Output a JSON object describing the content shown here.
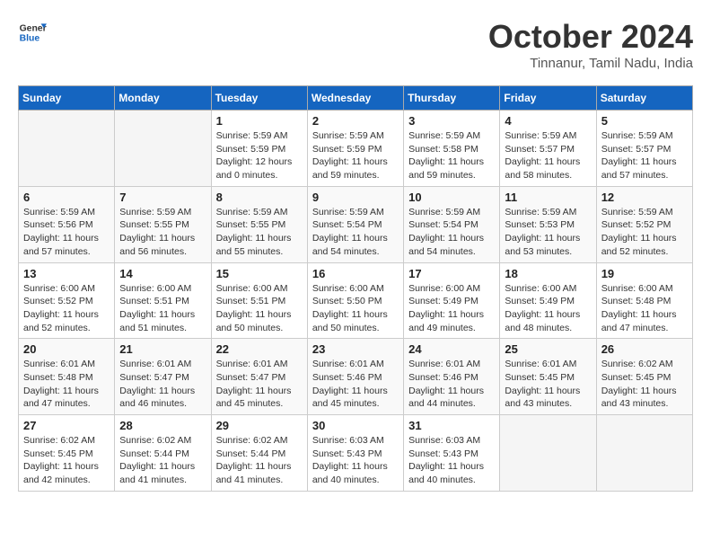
{
  "logo": {
    "line1": "General",
    "line2": "Blue"
  },
  "title": "October 2024",
  "subtitle": "Tinnanur, Tamil Nadu, India",
  "days_of_week": [
    "Sunday",
    "Monday",
    "Tuesday",
    "Wednesday",
    "Thursday",
    "Friday",
    "Saturday"
  ],
  "weeks": [
    [
      {
        "day": "",
        "info": ""
      },
      {
        "day": "",
        "info": ""
      },
      {
        "day": "1",
        "info": "Sunrise: 5:59 AM\nSunset: 5:59 PM\nDaylight: 12 hours\nand 0 minutes."
      },
      {
        "day": "2",
        "info": "Sunrise: 5:59 AM\nSunset: 5:59 PM\nDaylight: 11 hours\nand 59 minutes."
      },
      {
        "day": "3",
        "info": "Sunrise: 5:59 AM\nSunset: 5:58 PM\nDaylight: 11 hours\nand 59 minutes."
      },
      {
        "day": "4",
        "info": "Sunrise: 5:59 AM\nSunset: 5:57 PM\nDaylight: 11 hours\nand 58 minutes."
      },
      {
        "day": "5",
        "info": "Sunrise: 5:59 AM\nSunset: 5:57 PM\nDaylight: 11 hours\nand 57 minutes."
      }
    ],
    [
      {
        "day": "6",
        "info": "Sunrise: 5:59 AM\nSunset: 5:56 PM\nDaylight: 11 hours\nand 57 minutes."
      },
      {
        "day": "7",
        "info": "Sunrise: 5:59 AM\nSunset: 5:55 PM\nDaylight: 11 hours\nand 56 minutes."
      },
      {
        "day": "8",
        "info": "Sunrise: 5:59 AM\nSunset: 5:55 PM\nDaylight: 11 hours\nand 55 minutes."
      },
      {
        "day": "9",
        "info": "Sunrise: 5:59 AM\nSunset: 5:54 PM\nDaylight: 11 hours\nand 54 minutes."
      },
      {
        "day": "10",
        "info": "Sunrise: 5:59 AM\nSunset: 5:54 PM\nDaylight: 11 hours\nand 54 minutes."
      },
      {
        "day": "11",
        "info": "Sunrise: 5:59 AM\nSunset: 5:53 PM\nDaylight: 11 hours\nand 53 minutes."
      },
      {
        "day": "12",
        "info": "Sunrise: 5:59 AM\nSunset: 5:52 PM\nDaylight: 11 hours\nand 52 minutes."
      }
    ],
    [
      {
        "day": "13",
        "info": "Sunrise: 6:00 AM\nSunset: 5:52 PM\nDaylight: 11 hours\nand 52 minutes."
      },
      {
        "day": "14",
        "info": "Sunrise: 6:00 AM\nSunset: 5:51 PM\nDaylight: 11 hours\nand 51 minutes."
      },
      {
        "day": "15",
        "info": "Sunrise: 6:00 AM\nSunset: 5:51 PM\nDaylight: 11 hours\nand 50 minutes."
      },
      {
        "day": "16",
        "info": "Sunrise: 6:00 AM\nSunset: 5:50 PM\nDaylight: 11 hours\nand 50 minutes."
      },
      {
        "day": "17",
        "info": "Sunrise: 6:00 AM\nSunset: 5:49 PM\nDaylight: 11 hours\nand 49 minutes."
      },
      {
        "day": "18",
        "info": "Sunrise: 6:00 AM\nSunset: 5:49 PM\nDaylight: 11 hours\nand 48 minutes."
      },
      {
        "day": "19",
        "info": "Sunrise: 6:00 AM\nSunset: 5:48 PM\nDaylight: 11 hours\nand 47 minutes."
      }
    ],
    [
      {
        "day": "20",
        "info": "Sunrise: 6:01 AM\nSunset: 5:48 PM\nDaylight: 11 hours\nand 47 minutes."
      },
      {
        "day": "21",
        "info": "Sunrise: 6:01 AM\nSunset: 5:47 PM\nDaylight: 11 hours\nand 46 minutes."
      },
      {
        "day": "22",
        "info": "Sunrise: 6:01 AM\nSunset: 5:47 PM\nDaylight: 11 hours\nand 45 minutes."
      },
      {
        "day": "23",
        "info": "Sunrise: 6:01 AM\nSunset: 5:46 PM\nDaylight: 11 hours\nand 45 minutes."
      },
      {
        "day": "24",
        "info": "Sunrise: 6:01 AM\nSunset: 5:46 PM\nDaylight: 11 hours\nand 44 minutes."
      },
      {
        "day": "25",
        "info": "Sunrise: 6:01 AM\nSunset: 5:45 PM\nDaylight: 11 hours\nand 43 minutes."
      },
      {
        "day": "26",
        "info": "Sunrise: 6:02 AM\nSunset: 5:45 PM\nDaylight: 11 hours\nand 43 minutes."
      }
    ],
    [
      {
        "day": "27",
        "info": "Sunrise: 6:02 AM\nSunset: 5:45 PM\nDaylight: 11 hours\nand 42 minutes."
      },
      {
        "day": "28",
        "info": "Sunrise: 6:02 AM\nSunset: 5:44 PM\nDaylight: 11 hours\nand 41 minutes."
      },
      {
        "day": "29",
        "info": "Sunrise: 6:02 AM\nSunset: 5:44 PM\nDaylight: 11 hours\nand 41 minutes."
      },
      {
        "day": "30",
        "info": "Sunrise: 6:03 AM\nSunset: 5:43 PM\nDaylight: 11 hours\nand 40 minutes."
      },
      {
        "day": "31",
        "info": "Sunrise: 6:03 AM\nSunset: 5:43 PM\nDaylight: 11 hours\nand 40 minutes."
      },
      {
        "day": "",
        "info": ""
      },
      {
        "day": "",
        "info": ""
      }
    ]
  ]
}
